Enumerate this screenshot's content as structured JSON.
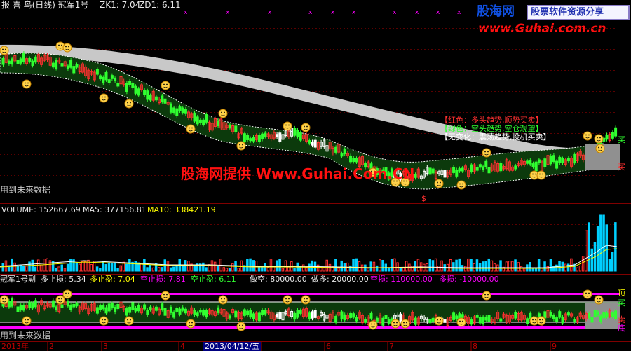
{
  "top_bar": {
    "title": "报 喜 鸟(日线) 冠军1号",
    "zk_label": "ZK1: 7.04",
    "zd_label": "ZD1: 6.11"
  },
  "main_chart": {
    "future_data_note": "用到未来数据",
    "watermark_center": "股海网提供 Www.Guhai.Com.CN",
    "legend_red": "【红色：多头趋势,顺势买卖】",
    "legend_green": "【绿色：空头趋势,空仓观望】",
    "legend_nochange": "【无变化：震荡趋势,投机买卖】",
    "side_buy": "买",
    "side_buy2": "买",
    "dollar_mark": "$"
  },
  "volume_panel": {
    "volume_label": "VOLUME: 152667.69",
    "ma5_label": "MA5: 377156.81",
    "ma10_label": "MA10: 338421.19"
  },
  "sub_panel": {
    "name": "冠军1号副",
    "long_stop": "多止损: 5.34",
    "long_profit": "多止盈: 7.04",
    "short_stop": "空止损: 7.81",
    "short_profit": "空止盈: 6.11",
    "do_short": "做空: 80000.00",
    "do_long": "做多: 20000.00",
    "short_loss": "空损: 110000.00",
    "long_loss": "多损: -10000.00",
    "future_data_note": "用到未来数据",
    "side_top": "顶",
    "side_buy": "买",
    "side_sell": "卖",
    "side_bottom": "底"
  },
  "axis": {
    "year_label": "2013年",
    "months": [
      "2",
      "3",
      "4",
      "5",
      "6",
      "7",
      "8",
      "9"
    ],
    "cursor_date": "2013/04/12/五"
  },
  "watermark": {
    "logo_text": "股海网",
    "logo_sub": "股票软件资源分享",
    "url": "www.Guhai.com.cn"
  },
  "colors": {
    "up": "#ff3030",
    "down": "#30ff30",
    "band": "#0c3a0c",
    "white_line": "#ffffff",
    "ma5": "#ffffff",
    "ma10": "#ffff00",
    "magenta": "#ff00ff",
    "cyan_bar": "#00d0ff",
    "grid_red": "#800000"
  }
}
